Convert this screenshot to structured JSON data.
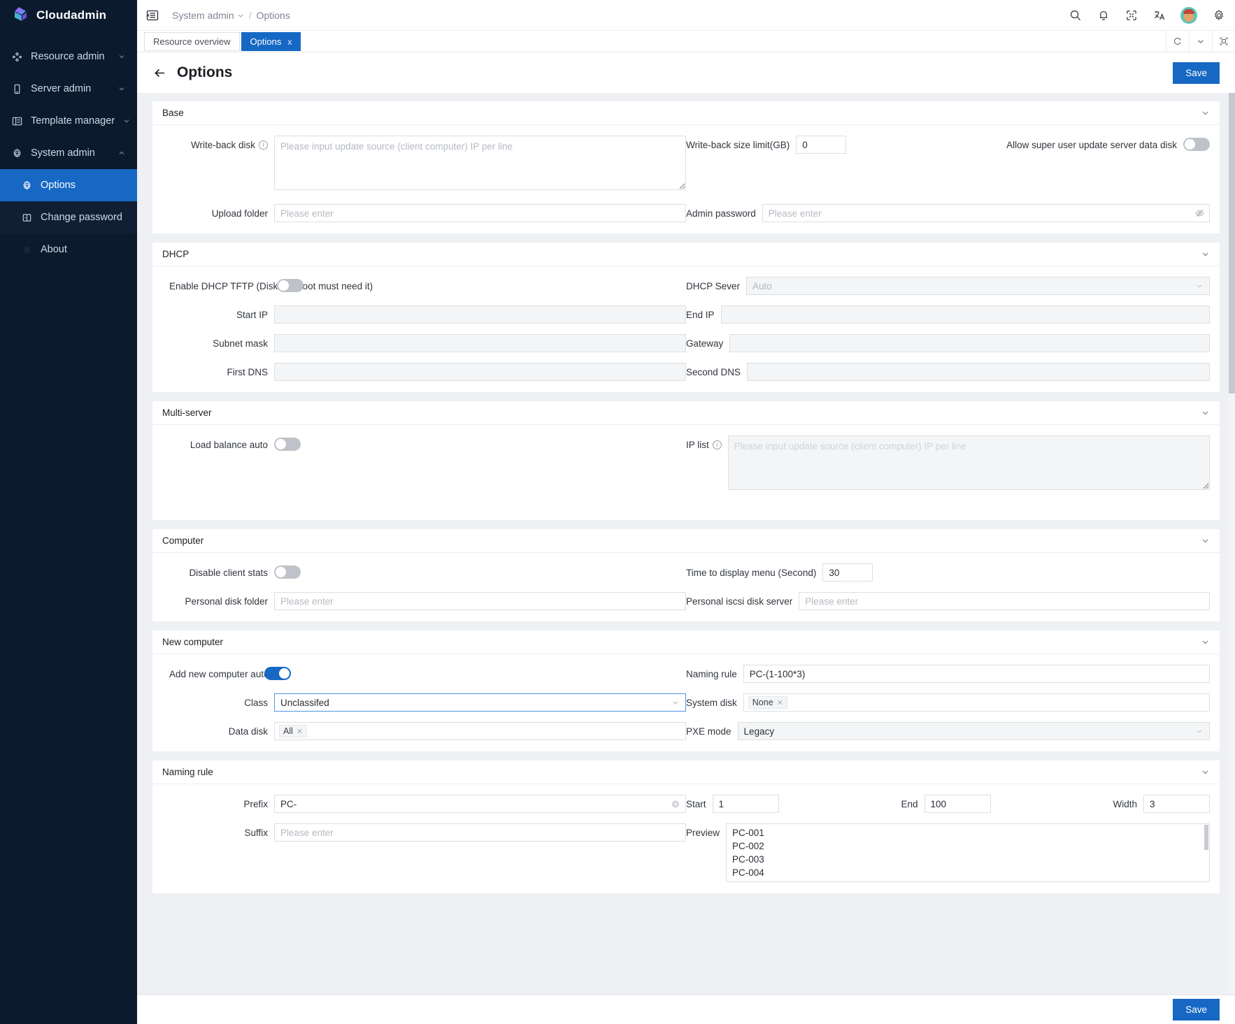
{
  "brand": {
    "name": "Cloudadmin"
  },
  "sidebar": {
    "items": [
      {
        "label": "Resource admin",
        "icon": "resource-icon",
        "expandable": true
      },
      {
        "label": "Server admin",
        "icon": "server-icon",
        "expandable": true
      },
      {
        "label": "Template manager",
        "icon": "template-icon",
        "expandable": true
      },
      {
        "label": "System admin",
        "icon": "gear-icon",
        "expandable": true,
        "expanded": true
      }
    ],
    "sub_items": [
      {
        "label": "Options",
        "icon": "gear-icon",
        "active": true
      },
      {
        "label": "Change password",
        "icon": "password-icon",
        "active": false
      }
    ],
    "about": {
      "label": "About"
    }
  },
  "topbar": {
    "breadcrumb": {
      "parent": "System admin",
      "separator": "/",
      "current": "Options"
    },
    "icons": [
      "search-icon",
      "bell-icon",
      "fullscreen-icon",
      "translate-icon",
      "avatar",
      "settings-icon"
    ]
  },
  "tabs": [
    {
      "label": "Resource overview",
      "active": false,
      "closable": false
    },
    {
      "label": "Options",
      "active": true,
      "closable": true,
      "close": "x"
    }
  ],
  "page": {
    "title": "Options",
    "save_label": "Save",
    "back_icon": "arrow-left-icon"
  },
  "sections": {
    "base": {
      "title": "Base",
      "write_back_disk": {
        "label": "Write-back disk",
        "placeholder": "Please input update source (client computer) IP per line",
        "value": "",
        "info": true
      },
      "write_back_size": {
        "label": "Write-back size limit(GB)",
        "value": "0"
      },
      "allow_super_user": {
        "label": "Allow super user update server data disk",
        "on": false
      },
      "upload_folder": {
        "label": "Upload folder",
        "placeholder": "Please enter",
        "value": ""
      },
      "admin_password": {
        "label": "Admin password",
        "placeholder": "Please enter",
        "value": "",
        "eye_icon": "eye-off-icon"
      }
    },
    "dhcp": {
      "title": "DHCP",
      "enable_tftp": {
        "label": "Enable DHCP TFTP (Diskless boot must need it)",
        "on": false
      },
      "dhcp_server": {
        "label": "DHCP Sever",
        "value": "Auto",
        "disabled": true
      },
      "start_ip": {
        "label": "Start IP",
        "value": "",
        "disabled": true
      },
      "end_ip": {
        "label": "End IP",
        "value": "",
        "disabled": true
      },
      "subnet_mask": {
        "label": "Subnet mask",
        "value": "",
        "disabled": true
      },
      "gateway": {
        "label": "Gateway",
        "value": "",
        "disabled": true
      },
      "first_dns": {
        "label": "First DNS",
        "value": "",
        "disabled": true
      },
      "second_dns": {
        "label": "Second DNS",
        "value": "",
        "disabled": true
      }
    },
    "multi_server": {
      "title": "Multi-server",
      "load_balance": {
        "label": "Load balance auto",
        "on": false
      },
      "ip_list": {
        "label": "IP list",
        "placeholder": "Please input update source (client computer) IP per line",
        "value": "",
        "info": true,
        "disabled": true
      }
    },
    "computer": {
      "title": "Computer",
      "disable_client_stats": {
        "label": "Disable client stats",
        "on": false
      },
      "time_to_display_menu": {
        "label": "Time to display menu (Second)",
        "value": "30"
      },
      "personal_disk_folder": {
        "label": "Personal disk folder",
        "placeholder": "Please enter",
        "value": ""
      },
      "personal_iscsi_disk_server": {
        "label": "Personal iscsi disk server",
        "placeholder": "Please enter",
        "value": ""
      }
    },
    "new_computer": {
      "title": "New computer",
      "add_new_auto": {
        "label": "Add new computer auto",
        "on": true
      },
      "naming_rule": {
        "label": "Naming rule",
        "value": "PC-(1-100*3)"
      },
      "class": {
        "label": "Class",
        "value": "Unclassifed",
        "focused": true
      },
      "system_disk": {
        "label": "System disk",
        "tags": [
          "None"
        ]
      },
      "data_disk": {
        "label": "Data disk",
        "tags": [
          "All"
        ]
      },
      "pxe_mode": {
        "label": "PXE mode",
        "value": "Legacy",
        "disabled": true
      }
    },
    "naming_rule": {
      "title": "Naming rule",
      "prefix": {
        "label": "Prefix",
        "value": "PC-",
        "clear_icon": "clear-circle-icon"
      },
      "suffix": {
        "label": "Suffix",
        "placeholder": "Please enter",
        "value": ""
      },
      "start": {
        "label": "Start",
        "value": "1"
      },
      "end": {
        "label": "End",
        "value": "100"
      },
      "width": {
        "label": "Width",
        "value": "3"
      },
      "preview": {
        "label": "Preview",
        "lines": [
          "PC-001",
          "PC-002",
          "PC-003",
          "PC-004"
        ]
      }
    }
  },
  "footer": {
    "save_label": "Save"
  },
  "colors": {
    "accent": "#1668c4",
    "sidebar_bg": "#0b1a2d",
    "page_bg": "#eef0f3"
  }
}
